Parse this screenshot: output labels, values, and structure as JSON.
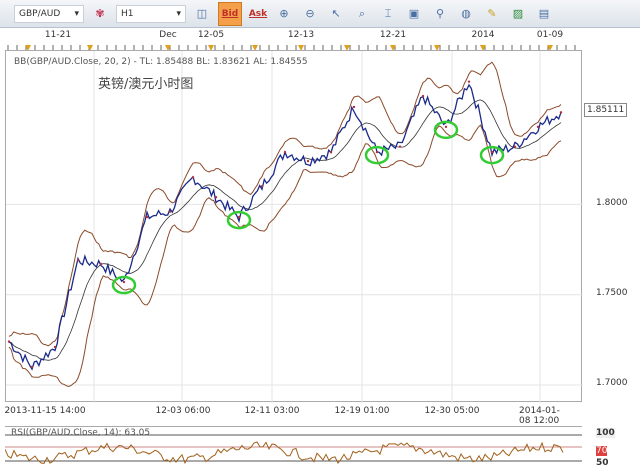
{
  "toolbar": {
    "symbol": "GBP/AUD",
    "timeframe": "H1",
    "bid": "Bid",
    "ask": "Ask"
  },
  "top_axis": [
    "11-21",
    "Dec",
    "12-05",
    "12-13",
    "12-21",
    "2014",
    "01-09"
  ],
  "legend": "BB(GBP/AUD.Close, 20, 2) -  TL: 1.85488  BL: 1.83621  AL: 1.84555",
  "rsi_legend": "RSI(GBP/AUD.Close, 14): 63.05",
  "rsi_levels": [
    "100",
    "70",
    "50"
  ],
  "current_price": "1.85111",
  "colors": {
    "price": "#1a2a8a",
    "band": "#8b4a2a",
    "highlight": "#33cc33",
    "rsi": "#a0601a",
    "bid_bg": "#f4a04a"
  },
  "chart_data": {
    "type": "line",
    "title": "英镑/澳元小时图",
    "x_labels": [
      "2013-11-15 14:00",
      "12-03 06:00",
      "12-11 03:00",
      "12-19 01:00",
      "12-30 05:00",
      "2014-01-08 12:00"
    ],
    "y_ticks": [
      "1.7000",
      "1.7500",
      "1.8000"
    ],
    "ylim": [
      1.69,
      1.885
    ],
    "series": [
      {
        "name": "GBP/AUD Close",
        "values": [
          1.724,
          1.71,
          1.721,
          1.769,
          1.767,
          1.757,
          1.793,
          1.796,
          1.815,
          1.804,
          1.793,
          1.81,
          1.829,
          1.824,
          1.829,
          1.854,
          1.829,
          1.832,
          1.86,
          1.843,
          1.868,
          1.829,
          1.832,
          1.843,
          1.851
        ]
      }
    ],
    "highlighted_lows": [
      5,
      10,
      16,
      19,
      21
    ],
    "indicator": "Bollinger Bands (20, 2)"
  }
}
